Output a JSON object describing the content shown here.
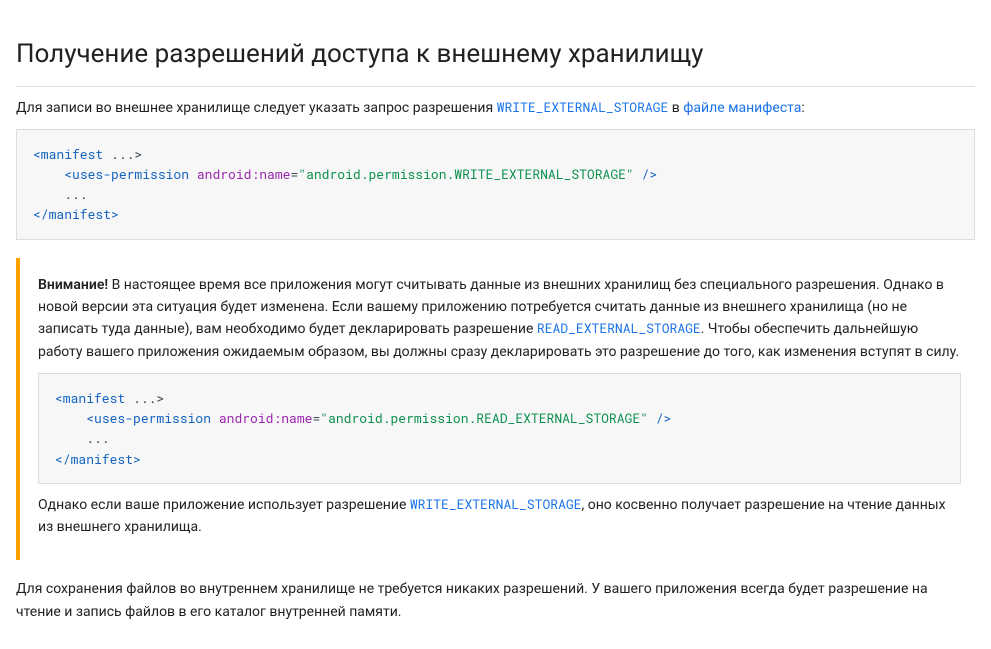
{
  "heading": "Получение разрешений доступа к внешнему хранилищу",
  "intro": {
    "text_before": "Для записи во внешнее хранилище следует указать запрос разрешения ",
    "code1": "WRITE_EXTERNAL_STORAGE",
    "text_mid": " в ",
    "link_manifest": "файле манифеста",
    "text_after": ":"
  },
  "code1": {
    "l1_open": "<manifest ",
    "l1_dots": "...>",
    "l2_indent": "    ",
    "l2_open": "<uses-permission ",
    "l2_attr": "android:name",
    "l2_eq": "=",
    "l2_val": "\"android.permission.WRITE_EXTERNAL_STORAGE\"",
    "l2_close": " />",
    "l3": "    ...",
    "l4": "</manifest>"
  },
  "note": {
    "caption": "Внимание!",
    "p1_a": " В настоящее время все приложения могут считывать данные из внешних хранилищ без специального разрешения. Однако в новой версии эта ситуация будет изменена. Если вашему приложению потребуется считать данные из внешнего хранилища (но не записать туда данные), вам необходимо будет декларировать разрешение ",
    "p1_code": "READ_EXTERNAL_STORAGE",
    "p1_b": ". Чтобы обеспечить дальнейшую работу вашего приложения ожидаемым образом, вы должны сразу декларировать это разрешение до того, как изменения вступят в силу.",
    "code2": {
      "l1_open": "<manifest ",
      "l1_dots": "...>",
      "l2_indent": "    ",
      "l2_open": "<uses-permission ",
      "l2_attr": "android:name",
      "l2_eq": "=",
      "l2_val": "\"android.permission.READ_EXTERNAL_STORAGE\"",
      "l2_close": " />",
      "l3": "    ...",
      "l4": "</manifest>"
    },
    "p2_a": "Однако если ваше приложение использует разрешение ",
    "p2_code": "WRITE_EXTERNAL_STORAGE",
    "p2_b": ", оно косвенно получает разрешение на чтение данных из внешнего хранилища."
  },
  "outro": "Для сохранения файлов во внутреннем хранилище не требуется никаких разрешений. У вашего приложения всегда будет разрешение на чтение и запись файлов в его каталог внутренней памяти."
}
